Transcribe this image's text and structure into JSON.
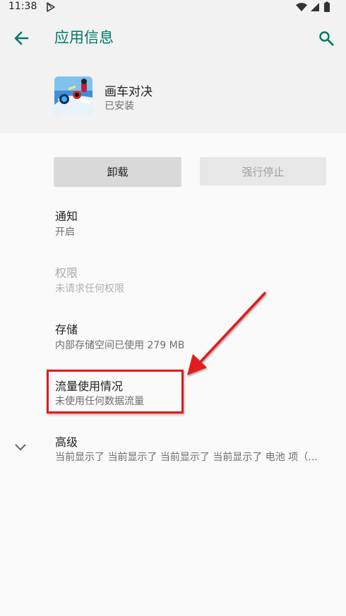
{
  "status_bar": {
    "time": "11:38"
  },
  "header": {
    "title": "应用信息",
    "back_icon": "arrow-back-icon",
    "search_icon": "search-icon"
  },
  "app": {
    "name": "画车对决",
    "status": "已安装"
  },
  "buttons": {
    "uninstall": "卸载",
    "force_stop": "强行停止"
  },
  "items": {
    "notifications": {
      "title": "通知",
      "subtitle": "开启"
    },
    "permissions": {
      "title": "权限",
      "subtitle": "未请求任何权限"
    },
    "storage": {
      "title": "存储",
      "subtitle": "内部存储空间已使用 279 MB"
    },
    "data_usage": {
      "title": "流量使用情况",
      "subtitle": "未使用任何数据流量"
    },
    "advanced": {
      "title": "高级",
      "subtitle": "当前显示了 当前显示了 当前显示了 当前显示了 电池 项（..."
    }
  },
  "colors": {
    "accent": "#00796b",
    "annotation": "#e01b1b"
  }
}
